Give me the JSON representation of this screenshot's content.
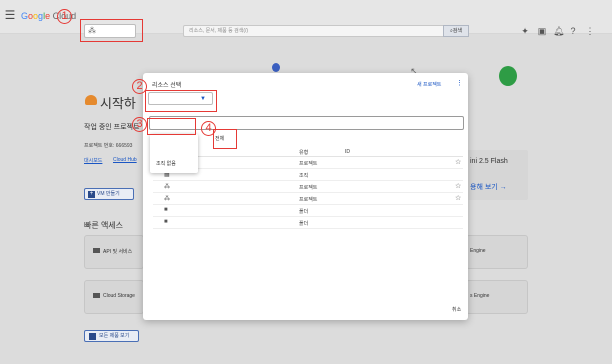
{
  "topbar": {
    "menu_icon": "menu-icon",
    "logo": [
      "G",
      "o",
      "o",
      "g",
      "l",
      "e"
    ],
    "logo_suffix": " Cloud",
    "search_placeholder": "리소스, 문서, 제품 등 검색(/)",
    "search_button": "검색"
  },
  "background": {
    "title": "시작하",
    "working_project": "작업 중인 프로젝트",
    "project_number": "프로젝트 번호: 666593",
    "dashboard_link": "대시보드",
    "cloud_hub_link": "Cloud Hub",
    "create_vm": "VM 만들기",
    "quick_access": "빠른 액세스",
    "api_service": "API 및 서비스",
    "cloud_storage": "Cloud Storage",
    "engine_1": "Engine",
    "engine_2": "s Engine",
    "right_card_title": "ini 2.5 Flash",
    "right_card_link": "용해 보기  →",
    "all_products": "모든 제품 보기"
  },
  "dialog": {
    "title": "리소스 선택",
    "new_project": "새 프로젝트",
    "all_tab": "전체",
    "no_org": "조직 없음",
    "col_type": "유형",
    "col_id": "ID",
    "rows": [
      {
        "type": "프로젝트",
        "star": true
      },
      {
        "type": "조직",
        "star": false
      },
      {
        "type": "프로젝트",
        "star": true
      },
      {
        "type": "프로젝트",
        "star": true
      },
      {
        "type": "폴더",
        "star": false
      },
      {
        "type": "폴더",
        "star": false
      }
    ],
    "cancel": "취소"
  },
  "annotations": [
    "1",
    "2",
    "3",
    "4"
  ],
  "colors": {
    "annotation": "#e53935",
    "link": "#1a56c4"
  }
}
